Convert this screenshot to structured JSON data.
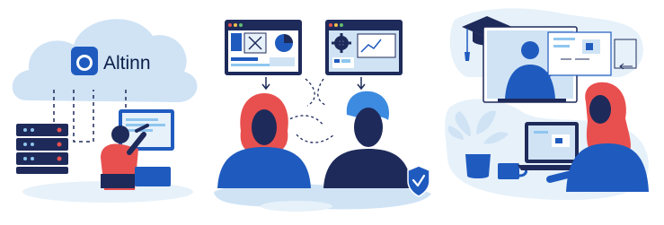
{
  "brand": {
    "name": "Altinn",
    "logo_icon": "altinn-logo-icon"
  },
  "colors": {
    "navy": "#1e2a5a",
    "blue": "#1f5bbf",
    "light_blue": "#cfe3f5",
    "pale_blue": "#e6f1fa",
    "red": "#e8504f",
    "skin": "#1e2a5a"
  },
  "panels": [
    {
      "id": "cloud-server-scene",
      "icons": [
        "cloud-icon",
        "server-rack-icon",
        "person-at-screen-icon"
      ]
    },
    {
      "id": "two-people-screens-scene",
      "icons": [
        "browser-window-icon",
        "gear-icon",
        "shield-check-icon"
      ]
    },
    {
      "id": "online-learning-scene",
      "icons": [
        "graduation-cap-icon",
        "teacher-screen-icon",
        "coffee-cup-icon",
        "plant-icon",
        "laptop-icon"
      ]
    }
  ]
}
